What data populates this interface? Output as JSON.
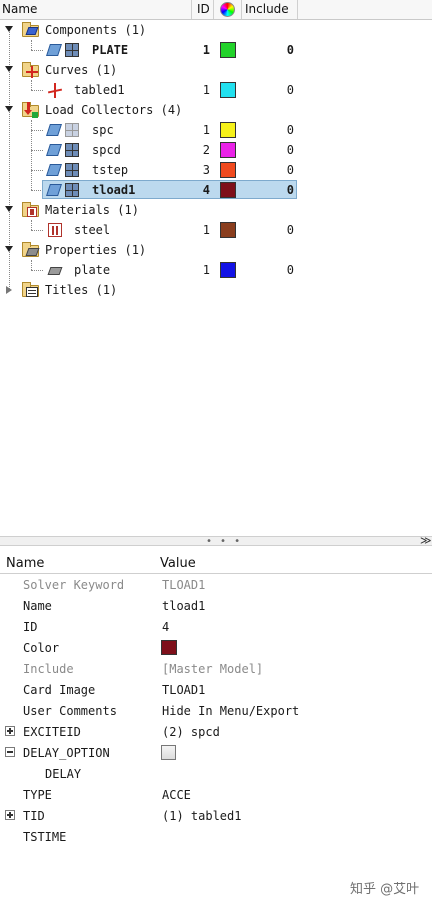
{
  "tree_header": {
    "name": "Name",
    "id": "ID",
    "include": "Include"
  },
  "tree": {
    "components": {
      "label": "Components (1)"
    },
    "plate_comp": {
      "label": "PLATE",
      "id": "1",
      "include": "0",
      "color": "#22d22a"
    },
    "curves": {
      "label": "Curves (1)"
    },
    "tabled1": {
      "label": "tabled1",
      "id": "1",
      "include": "0",
      "color": "#22e0ee"
    },
    "load_collectors": {
      "label": "Load Collectors (4)"
    },
    "spc": {
      "label": "spc",
      "id": "1",
      "include": "0",
      "color": "#f6f21a"
    },
    "spcd": {
      "label": "spcd",
      "id": "2",
      "include": "0",
      "color": "#ea22e8"
    },
    "tstep": {
      "label": "tstep",
      "id": "3",
      "include": "0",
      "color": "#f04a1e"
    },
    "tload1": {
      "label": "tload1",
      "id": "4",
      "include": "0",
      "color": "#7e0f1a"
    },
    "materials": {
      "label": "Materials (1)"
    },
    "steel": {
      "label": "steel",
      "id": "1",
      "include": "0",
      "color": "#8a3e1e"
    },
    "properties": {
      "label": "Properties (1)"
    },
    "plate_prop": {
      "label": "plate",
      "id": "1",
      "include": "0",
      "color": "#1212e6"
    },
    "titles": {
      "label": "Titles (1)"
    }
  },
  "splitter": {
    "grip": "• • •",
    "collapse": "≫"
  },
  "props_header": {
    "name": "Name",
    "value": "Value"
  },
  "props": {
    "solver_keyword": {
      "name": "Solver Keyword",
      "value": "TLOAD1"
    },
    "name": {
      "name": "Name",
      "value": "tload1"
    },
    "id": {
      "name": "ID",
      "value": "4"
    },
    "color": {
      "name": "Color",
      "value": "#7e0f1a"
    },
    "include": {
      "name": "Include",
      "value": "[Master Model]"
    },
    "card_image": {
      "name": "Card Image",
      "value": "TLOAD1"
    },
    "user_comments": {
      "name": "User Comments",
      "value": "Hide In Menu/Export"
    },
    "exciteid": {
      "name": "EXCITEID",
      "value": "(2) spcd"
    },
    "delay_option": {
      "name": "DELAY_OPTION",
      "value": "unchecked"
    },
    "delay": {
      "name": "DELAY"
    },
    "type": {
      "name": "TYPE",
      "value": "ACCE"
    },
    "tid": {
      "name": "TID",
      "value": "(1) tabled1"
    },
    "tstime": {
      "name": "TSTIME"
    }
  },
  "watermark": "知乎 @艾叶"
}
